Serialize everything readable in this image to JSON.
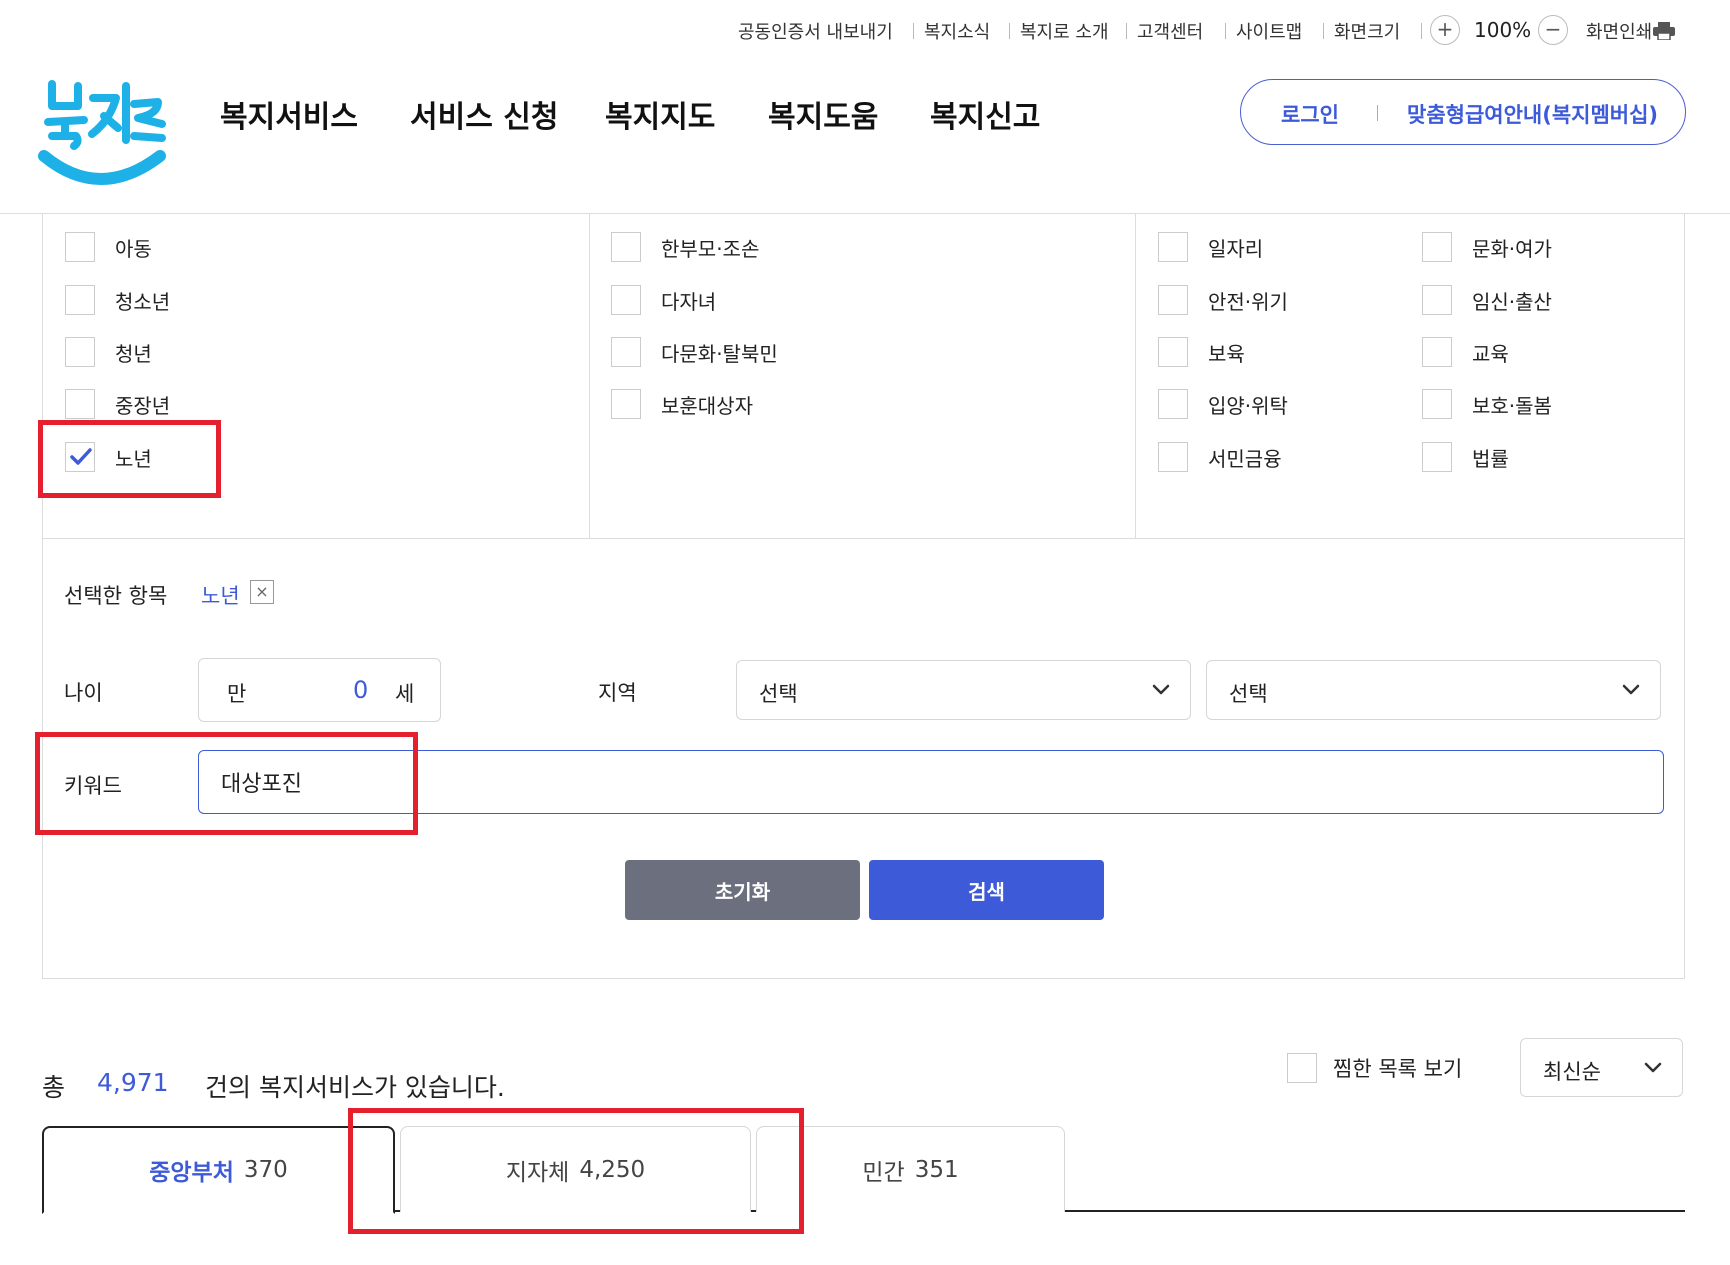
{
  "utility": {
    "cert_export": "공동인증서 내보내기",
    "news": "복지소식",
    "about": "복지로 소개",
    "customer_center": "고객센터",
    "sitemap": "사이트맵",
    "screen_size": "화면크기",
    "zoom_in": "+",
    "zoom_value": "100%",
    "zoom_out": "−",
    "print": "화면인쇄"
  },
  "header": {
    "nav": [
      "복지서비스",
      "서비스 신청",
      "복지지도",
      "복지도움",
      "복지신고"
    ],
    "login": "로그인",
    "membership": "맞춤형급여안내(복지멤버십)"
  },
  "filters": {
    "life_cycle": [
      {
        "label": "아동",
        "checked": false
      },
      {
        "label": "청소년",
        "checked": false
      },
      {
        "label": "청년",
        "checked": false
      },
      {
        "label": "중장년",
        "checked": false
      },
      {
        "label": "노년",
        "checked": true
      }
    ],
    "household": [
      {
        "label": "한부모·조손",
        "checked": false
      },
      {
        "label": "다자녀",
        "checked": false
      },
      {
        "label": "다문화·탈북민",
        "checked": false
      },
      {
        "label": "보훈대상자",
        "checked": false
      }
    ],
    "topics_col1": [
      {
        "label": "일자리",
        "checked": false
      },
      {
        "label": "안전·위기",
        "checked": false
      },
      {
        "label": "보육",
        "checked": false
      },
      {
        "label": "입양·위탁",
        "checked": false
      },
      {
        "label": "서민금융",
        "checked": false
      }
    ],
    "topics_col2": [
      {
        "label": "문화·여가",
        "checked": false
      },
      {
        "label": "임신·출산",
        "checked": false
      },
      {
        "label": "교육",
        "checked": false
      },
      {
        "label": "보호·돌봄",
        "checked": false
      },
      {
        "label": "법률",
        "checked": false
      }
    ]
  },
  "selected": {
    "label": "선택한 항목",
    "tag": "노년",
    "remove": "×"
  },
  "age": {
    "label": "나이",
    "prefix": "만",
    "value": "0",
    "suffix": "세"
  },
  "region": {
    "label": "지역",
    "select1": "선택",
    "select2": "선택"
  },
  "keyword": {
    "label": "키워드",
    "value": "대상포진"
  },
  "buttons": {
    "reset": "초기화",
    "search": "검색"
  },
  "results": {
    "prefix": "총",
    "total": "4,971",
    "suffix": "건의 복지서비스가 있습니다.",
    "favorites": "찜한 목록 보기",
    "sort": "최신순"
  },
  "tabs": [
    {
      "name": "중앙부처",
      "count": "370",
      "active": true
    },
    {
      "name": "지자체",
      "count": "4,250",
      "active": false
    },
    {
      "name": "민간",
      "count": "351",
      "active": false
    }
  ],
  "colors": {
    "accent": "#3d5bd9",
    "annotation": "#e5202e",
    "logo_blue": "#1eb1e8"
  }
}
